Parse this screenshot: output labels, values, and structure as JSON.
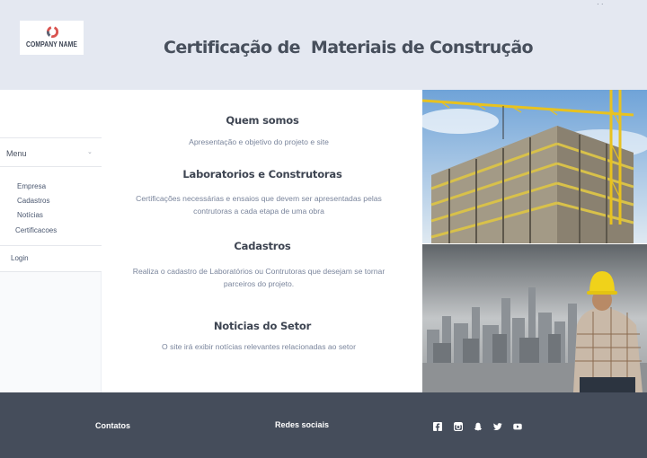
{
  "header": {
    "logo_text": "COMPANY NAME",
    "title": "Certificação de  Materiais de Construção",
    "corner_mark": "· ·"
  },
  "sidebar": {
    "menu_label": "Menu",
    "menu_caret": "⌄",
    "items": [
      {
        "label": "Empresa"
      },
      {
        "label": "Cadastros"
      },
      {
        "label": "Notícias"
      },
      {
        "label": "Certificacoes"
      }
    ],
    "login_label": "Login"
  },
  "sections": [
    {
      "title": "Quem somos",
      "text": "Apresentação e objetivo do projeto  e site"
    },
    {
      "title": "Laboratorios e Construtoras",
      "text": "Certificações necessárias e ensaios que devem ser apresentadas pelas contrutoras a cada etapa de uma obra"
    },
    {
      "title": "Cadastros",
      "text": "Realiza o cadastro de Laboratórios ou Contrutoras que desejam se tornar parceiros do projeto."
    },
    {
      "title": "Noticias do Setor",
      "text": "O site irá exibir notícias relevantes relacionadas ao setor"
    }
  ],
  "footer": {
    "contacts_label": "Contatos",
    "social_label": "Redes sociais",
    "social_icons": [
      "facebook-icon",
      "instagram-icon",
      "snapchat-icon",
      "twitter-icon",
      "youtube-icon"
    ]
  },
  "colors": {
    "header_bg": "#e4e8f1",
    "footer_bg": "#454d5b",
    "title_text": "#474f5c",
    "body_text": "#7a859c",
    "link_text": "#4b5870"
  }
}
